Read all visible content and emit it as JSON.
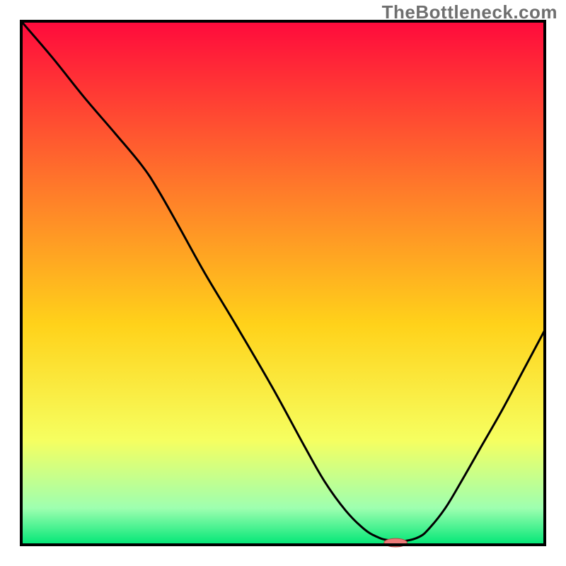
{
  "watermark": "TheBottleneck.com",
  "colors": {
    "gradient_top": "#ff0a3c",
    "gradient_upper_mid": "#ff7a2a",
    "gradient_mid": "#ffd21a",
    "gradient_lower_mid": "#f6ff60",
    "gradient_near_bottom": "#9effb0",
    "gradient_bottom": "#00e676",
    "frame": "#000000",
    "curve": "#000000",
    "marker_fill": "#ec7a78",
    "marker_stroke": "#b74a48",
    "background": "#ffffff"
  },
  "chart_data": {
    "type": "line",
    "title": "",
    "xlabel": "",
    "ylabel": "",
    "x_range": [
      0,
      100
    ],
    "y_range": [
      0,
      100
    ],
    "curve_points_percent": [
      [
        0.0,
        100.0
      ],
      [
        6.0,
        93.0
      ],
      [
        12.0,
        85.5
      ],
      [
        18.0,
        78.5
      ],
      [
        23.0,
        72.5
      ],
      [
        26.0,
        68.0
      ],
      [
        30.0,
        61.0
      ],
      [
        35.0,
        52.0
      ],
      [
        41.0,
        42.0
      ],
      [
        48.0,
        30.0
      ],
      [
        54.0,
        19.0
      ],
      [
        58.0,
        12.0
      ],
      [
        62.0,
        6.5
      ],
      [
        65.5,
        3.0
      ],
      [
        68.0,
        1.5
      ],
      [
        70.0,
        0.9
      ],
      [
        73.0,
        0.7
      ],
      [
        76.0,
        1.5
      ],
      [
        78.0,
        3.2
      ],
      [
        81.0,
        7.0
      ],
      [
        84.0,
        12.0
      ],
      [
        88.0,
        19.0
      ],
      [
        92.0,
        26.0
      ],
      [
        96.0,
        33.5
      ],
      [
        100.0,
        41.0
      ]
    ],
    "marker_percent": {
      "cx": 71.5,
      "cy": 0.4,
      "rx": 2.2,
      "ry": 0.8
    },
    "annotations": []
  }
}
